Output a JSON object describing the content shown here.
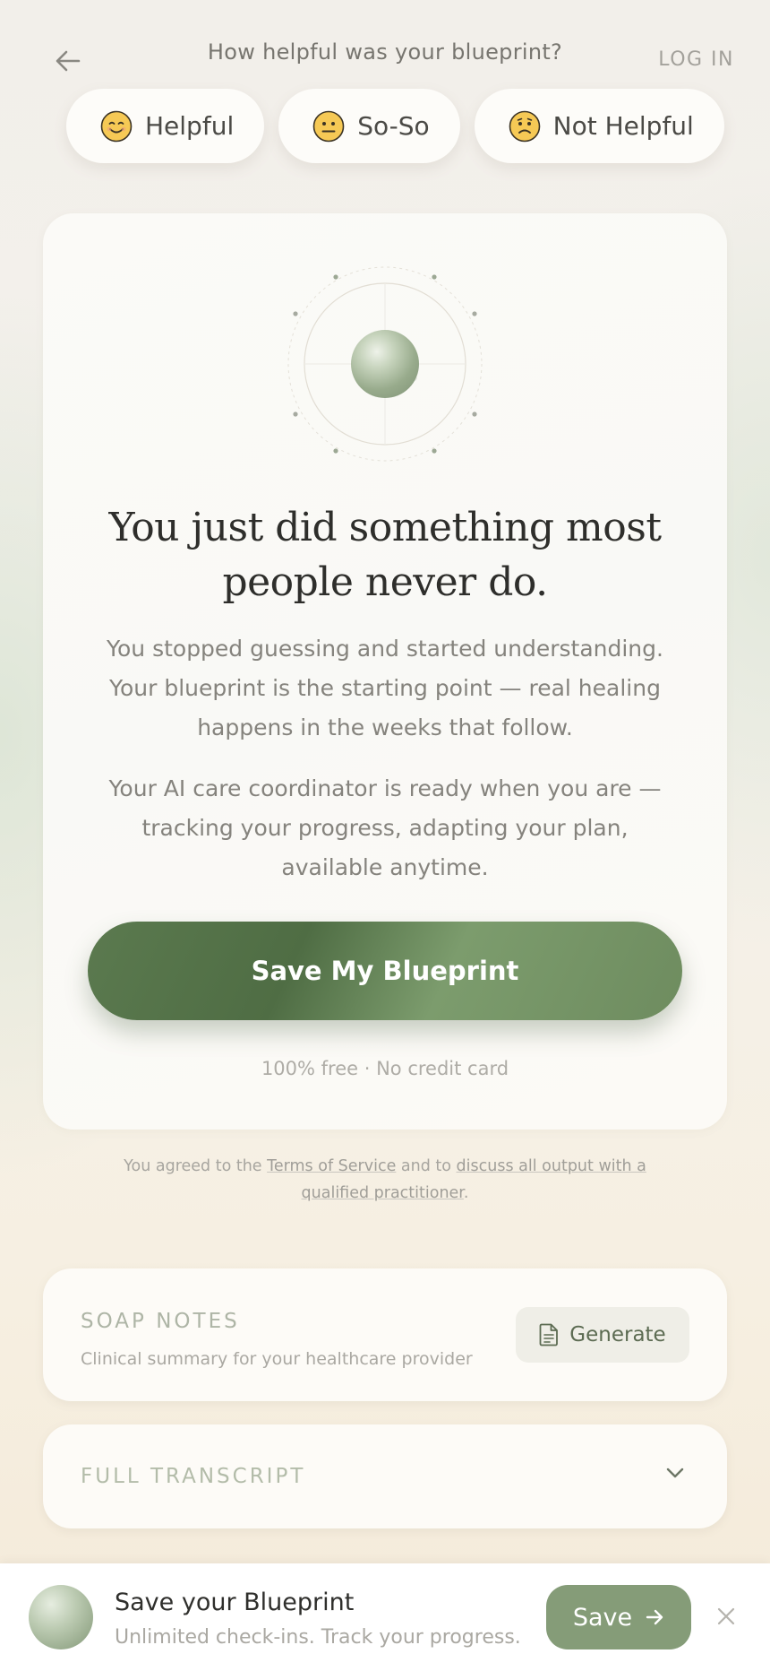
{
  "header": {
    "question": "How helpful was your blueprint?",
    "login": "LOG IN"
  },
  "feedback": [
    {
      "label": "Helpful",
      "icon": "smiling-face-icon"
    },
    {
      "label": "So-So",
      "icon": "neutral-face-icon"
    },
    {
      "label": "Not Helpful",
      "icon": "frowning-face-icon"
    }
  ],
  "card": {
    "headline": "You just did something most people never do.",
    "body1": "You stopped guessing and started understanding. Your blueprint is the starting point — real healing happens in the weeks that follow.",
    "body2": "Your AI care coordinator is ready when you are — tracking your progress, adapting your plan, available anytime.",
    "cta": "Save My Blueprint",
    "fine": "100% free · No credit card"
  },
  "terms": {
    "prefix": "You agreed to the ",
    "tos": "Terms of Service",
    "middle": " and to ",
    "discuss": "discuss all output with a qualified practitioner",
    "suffix": "."
  },
  "soap": {
    "title": "SOAP NOTES",
    "subtitle": "Clinical summary for your healthcare provider",
    "button": "Generate"
  },
  "transcript": {
    "title": "FULL TRANSCRIPT"
  },
  "bottom_bar": {
    "title": "Save your Blueprint",
    "subtitle": "Unlimited check-ins. Track your progress. ...",
    "button": "Save"
  },
  "colors": {
    "accent": "#5b7a4f",
    "button_muted": "#859c78"
  }
}
